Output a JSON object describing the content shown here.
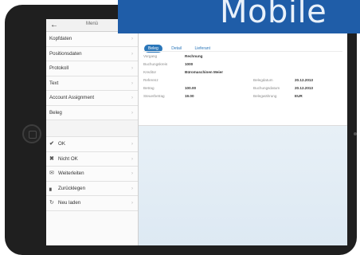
{
  "banner": {
    "text": "Mobile"
  },
  "master": {
    "title": "Menü",
    "back_icon": "back-arrow-icon",
    "items": [
      {
        "label": "Kopfdaten"
      },
      {
        "label": "Positionsdaten"
      },
      {
        "label": "Protokoll"
      },
      {
        "label": "Text"
      },
      {
        "label": "Account Assignment"
      },
      {
        "label": "Beleg"
      }
    ],
    "actions": [
      {
        "label": "OK",
        "icon": "check-icon"
      },
      {
        "label": "Nicht OK",
        "icon": "cross-icon"
      },
      {
        "label": "Weiterleiten",
        "icon": "mail-icon"
      },
      {
        "label": "Zurücklegen",
        "icon": "bar-chart-icon"
      },
      {
        "label": "Neu laden",
        "icon": "reload-icon"
      }
    ]
  },
  "detail": {
    "tabs": [
      "Beleg",
      "Detail",
      "Lieferant"
    ],
    "fields_left": [
      {
        "label": "Vorgang",
        "value": "Rechnung"
      },
      {
        "label": "Buchungskreis",
        "value": "1000"
      },
      {
        "label": "Kreditor",
        "value": "Büromaschinen Meier"
      },
      {
        "label": "Referenz",
        "value": ""
      },
      {
        "label": "Betrag",
        "value": "100.00"
      },
      {
        "label": "Steuerbetrag",
        "value": "19.00"
      }
    ],
    "fields_right": [
      {
        "label": "Belegdatum",
        "value": "20.12.2013"
      },
      {
        "label": "Buchungsdatum",
        "value": "20.12.2013"
      },
      {
        "label": "Belegwährung",
        "value": "EUR"
      }
    ]
  },
  "colors": {
    "accent": "#2a76b9",
    "banner": "#1f5da8"
  }
}
